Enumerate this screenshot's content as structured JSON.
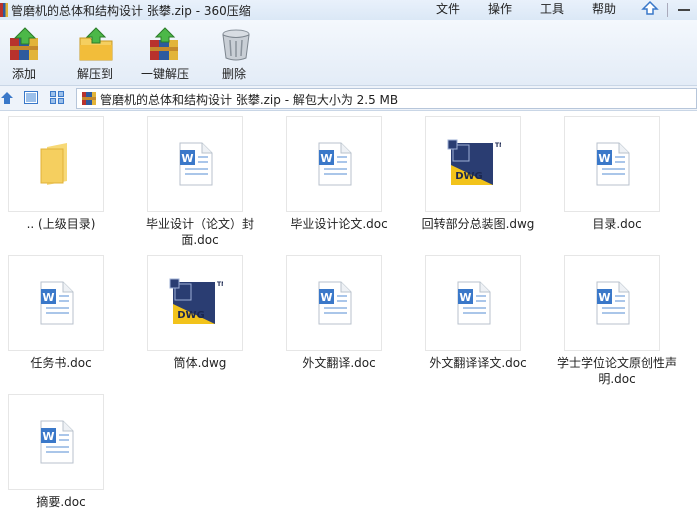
{
  "window": {
    "title": "管磨机的总体和结构设计 张攀.zip - 360压缩",
    "menu": [
      "文件",
      "操作",
      "工具",
      "帮助"
    ]
  },
  "toolbar": {
    "add_label": "添加",
    "extract_label": "解压到",
    "oneclick_label": "一键解压",
    "delete_label": "删除"
  },
  "address": {
    "path": "管磨机的总体和结构设计 张攀.zip - 解包大小为 2.5 MB"
  },
  "files": [
    {
      "name": ".. (上级目录)",
      "type": "folder-up"
    },
    {
      "name": "毕业设计（论文）封面.doc",
      "type": "doc"
    },
    {
      "name": "毕业设计论文.doc",
      "type": "doc"
    },
    {
      "name": "回转部分总装图.dwg",
      "type": "dwg"
    },
    {
      "name": "目录.doc",
      "type": "doc"
    },
    {
      "name": "任务书.doc",
      "type": "doc"
    },
    {
      "name": "筒体.dwg",
      "type": "dwg"
    },
    {
      "name": "外文翻译.doc",
      "type": "doc"
    },
    {
      "name": "外文翻译译文.doc",
      "type": "doc"
    },
    {
      "name": "学士学位论文原创性声明.doc",
      "type": "doc"
    },
    {
      "name": "摘要.doc",
      "type": "doc"
    }
  ],
  "colors": {
    "title_bar": "#dbe8f6",
    "toolbar": "#e3ecf7",
    "word_blue": "#3a78c9",
    "dwg_navy": "#2a3d72",
    "dwg_yellow": "#f2c31b",
    "folder_yellow": "#f5cf5f"
  }
}
